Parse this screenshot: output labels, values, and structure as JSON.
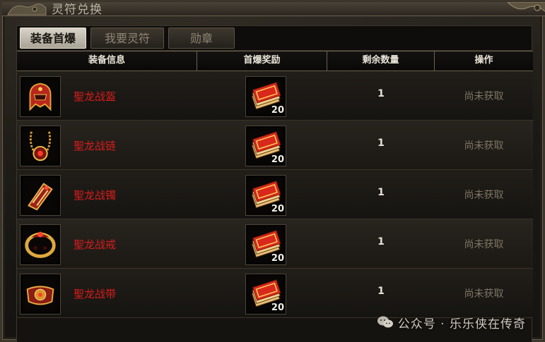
{
  "window": {
    "title": "灵符兑换"
  },
  "tabs": [
    {
      "label": "装备首爆",
      "active": true
    },
    {
      "label": "我要灵符",
      "active": false
    },
    {
      "label": "勋章",
      "active": false
    }
  ],
  "table": {
    "headers": [
      "装备信息",
      "首爆奖励",
      "剩余数量",
      "操作"
    ],
    "rows": [
      {
        "item_name": "聖龙战盔",
        "item_icon": "helmet-icon",
        "reward_icon": "talisman-stack-icon",
        "reward_count": "20",
        "remaining": "1",
        "action": "尚未获取"
      },
      {
        "item_name": "聖龙战链",
        "item_icon": "necklace-icon",
        "reward_icon": "talisman-stack-icon",
        "reward_count": "20",
        "remaining": "1",
        "action": "尚未获取"
      },
      {
        "item_name": "聖龙战镯",
        "item_icon": "bracelet-icon",
        "reward_icon": "talisman-stack-icon",
        "reward_count": "20",
        "remaining": "1",
        "action": "尚未获取"
      },
      {
        "item_name": "聖龙战戒",
        "item_icon": "ring-icon",
        "reward_icon": "talisman-stack-icon",
        "reward_count": "20",
        "remaining": "1",
        "action": "尚未获取"
      },
      {
        "item_name": "聖龙战带",
        "item_icon": "belt-icon",
        "reward_icon": "talisman-stack-icon",
        "reward_count": "20",
        "remaining": "1",
        "action": "尚未获取"
      }
    ]
  },
  "watermark": {
    "text": "公众号 · 乐乐侠在传奇"
  },
  "colors": {
    "item_name": "#d81c1c",
    "action_disabled": "#7d7666",
    "gold_border": "#6c624f"
  }
}
